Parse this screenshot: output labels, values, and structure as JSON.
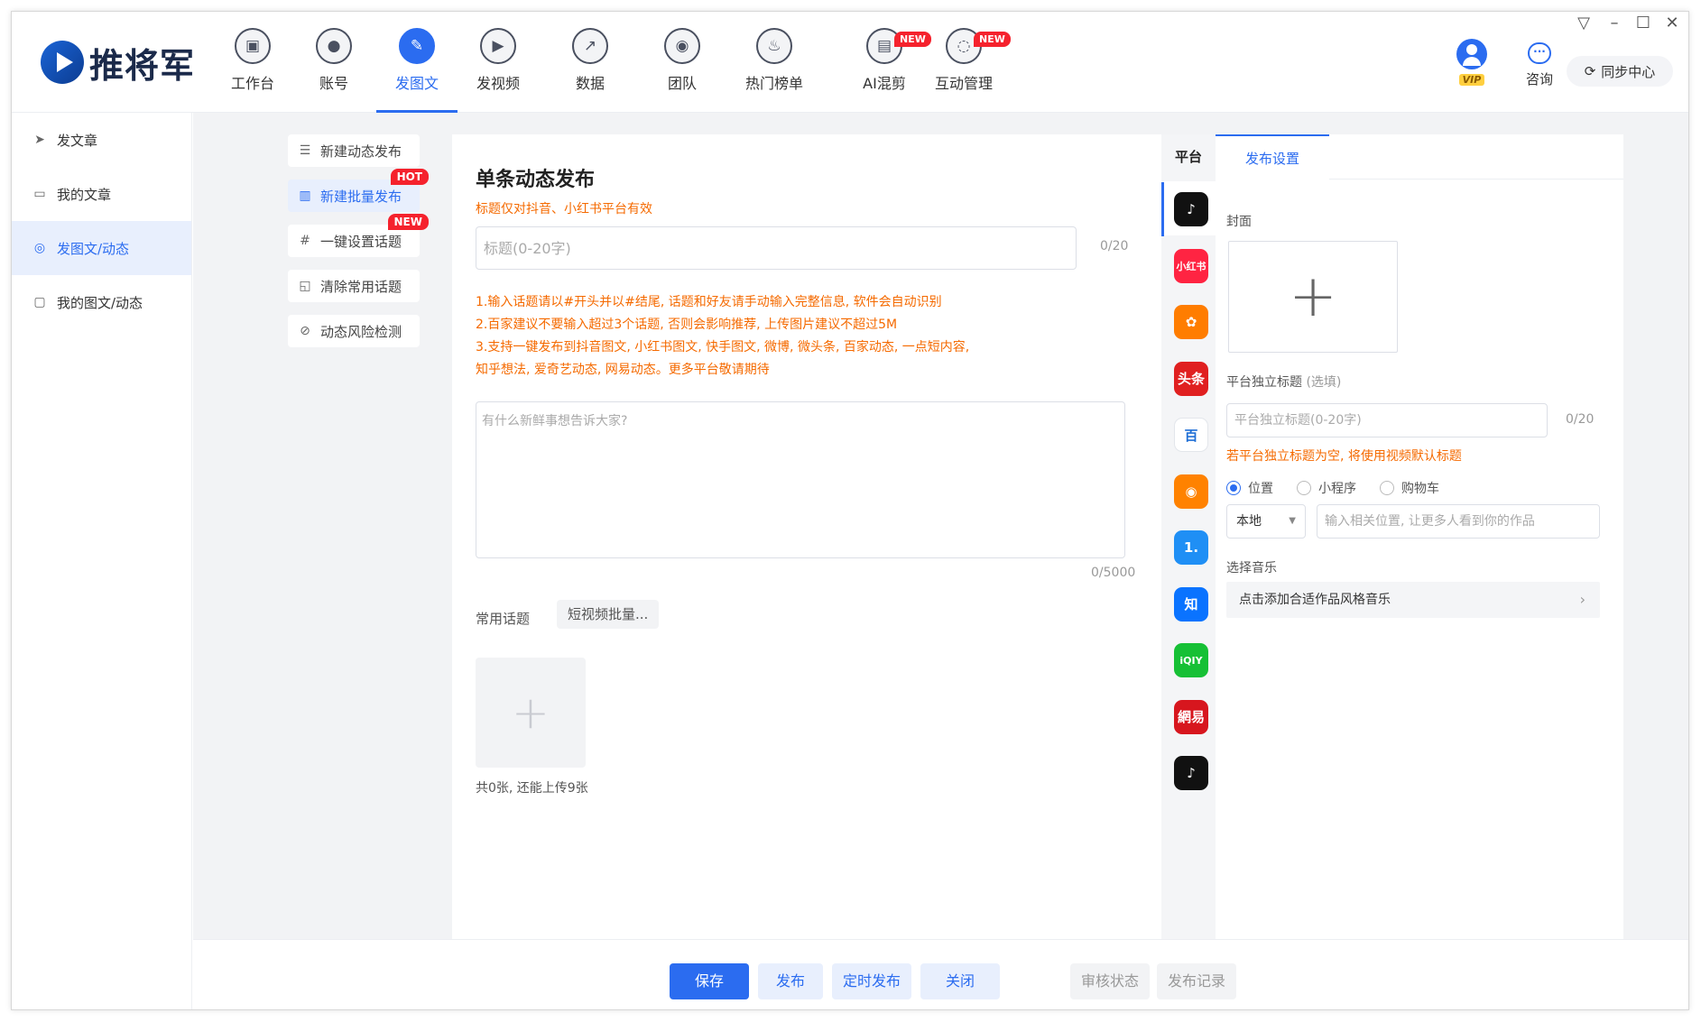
{
  "app": {
    "name": "推将军"
  },
  "nav": [
    {
      "label": "工作台",
      "icon": "monitor-icon",
      "glyph": "▣"
    },
    {
      "label": "账号",
      "icon": "user-icon",
      "glyph": "●"
    },
    {
      "label": "发图文",
      "icon": "feather-icon",
      "glyph": "✎",
      "active": true
    },
    {
      "label": "发视频",
      "icon": "play-icon",
      "glyph": "▶"
    },
    {
      "label": "数据",
      "icon": "chart-icon",
      "glyph": "↗"
    },
    {
      "label": "团队",
      "icon": "team-icon",
      "glyph": "◉"
    },
    {
      "label": "热门榜单",
      "icon": "fire-icon",
      "glyph": "♨"
    },
    {
      "label": "AI混剪",
      "icon": "briefcase-icon",
      "glyph": "▤",
      "badge": "NEW"
    },
    {
      "label": "互动管理",
      "icon": "chat-icon",
      "glyph": "◌",
      "badge": "NEW"
    }
  ],
  "header": {
    "vip": "VIP",
    "consult": "咨询",
    "sync": "同步中心"
  },
  "sidebar": [
    {
      "label": "发文章",
      "icon": "send-icon",
      "glyph": "➤"
    },
    {
      "label": "我的文章",
      "icon": "document-icon",
      "glyph": "▭"
    },
    {
      "label": "发图文/动态",
      "icon": "target-icon",
      "glyph": "◎",
      "active": true
    },
    {
      "label": "我的图文/动态",
      "icon": "message-icon",
      "glyph": "▢"
    }
  ],
  "tools": [
    {
      "label": "新建动态发布",
      "icon": "list-icon",
      "glyph": "☰"
    },
    {
      "label": "新建批量发布",
      "icon": "batch-icon",
      "glyph": "▥",
      "tag": "HOT",
      "active": true
    },
    {
      "label": "一键设置话题",
      "icon": "hash-icon",
      "glyph": "#",
      "tag": "NEW"
    },
    {
      "label": "清除常用话题",
      "icon": "clear-icon",
      "glyph": "◱"
    },
    {
      "label": "动态风险检测",
      "icon": "shield-check-icon",
      "glyph": "⊘"
    }
  ],
  "editor": {
    "title": "单条动态发布",
    "hint": "标题仅对抖音、小红书平台有效",
    "title_placeholder": "标题(0-20字)",
    "title_counter": "0/20",
    "notes": [
      "1.输入话题请以#开头并以#结尾, 话题和好友请手动输入完整信息, 软件会自动识别",
      "2.百家建议不要输入超过3个话题, 否则会影响推荐, 上传图片建议不超过5M",
      "3.支持一键发布到抖音图文, 小红书图文, 快手图文, 微博, 微头条, 百家动态, 一点短内容,",
      "  知乎想法, 爱奇艺动态, 网易动态。更多平台敬请期待"
    ],
    "content_placeholder": "有什么新鲜事想告诉大家?",
    "content_counter": "0/5000",
    "topics_label": "常用话题",
    "topic_chip": "短视频批量...",
    "upload_count": "共0张, 还能上传9张"
  },
  "platforms": {
    "title": "平台",
    "items": [
      {
        "name": "douyin-icon",
        "label": "♪",
        "color": "#111111"
      },
      {
        "name": "xiaohongshu-icon",
        "label": "小红书",
        "color": "#ff2442"
      },
      {
        "name": "kuaishou-icon",
        "label": "✿",
        "color": "#ff7d00"
      },
      {
        "name": "toutiao-icon",
        "label": "头条",
        "color": "#e02020"
      },
      {
        "name": "baijia-icon",
        "label": "百",
        "color": "#ffffff"
      },
      {
        "name": "weibo-icon",
        "label": "◉",
        "color": "#ff8200"
      },
      {
        "name": "yidian-icon",
        "label": "1.",
        "color": "#1f8ff5"
      },
      {
        "name": "zhihu-icon",
        "label": "知",
        "color": "#0a73ff"
      },
      {
        "name": "iqiyi-icon",
        "label": "iQIY",
        "color": "#16c035"
      },
      {
        "name": "netease-icon",
        "label": "網易",
        "color": "#d7161e"
      },
      {
        "name": "douyin-alt-icon",
        "label": "♪",
        "color": "#111111"
      }
    ]
  },
  "settings": {
    "tab": "发布设置",
    "cover_label": "封面",
    "platform_title_label": "平台独立标题",
    "platform_title_optional": "(选填)",
    "platform_title_placeholder": "平台独立标题(0-20字)",
    "platform_title_counter": "0/20",
    "platform_title_warn": "若平台独立标题为空, 将使用视频默认标题",
    "radios": [
      {
        "label": "位置",
        "selected": true
      },
      {
        "label": "小程序",
        "selected": false
      },
      {
        "label": "购物车",
        "selected": false
      }
    ],
    "local_value": "本地",
    "location_placeholder": "输入相关位置, 让更多人看到你的作品",
    "music_label": "选择音乐",
    "music_row": "点击添加合适作品风格音乐"
  },
  "bottom": {
    "save": "保存",
    "publish": "发布",
    "scheduled": "定时发布",
    "close": "关闭",
    "review_status": "审核状态",
    "publish_log": "发布记录"
  },
  "colors": {
    "accent": "#2b6cf0",
    "warning": "#f56a00",
    "badge": "#f5222d"
  }
}
